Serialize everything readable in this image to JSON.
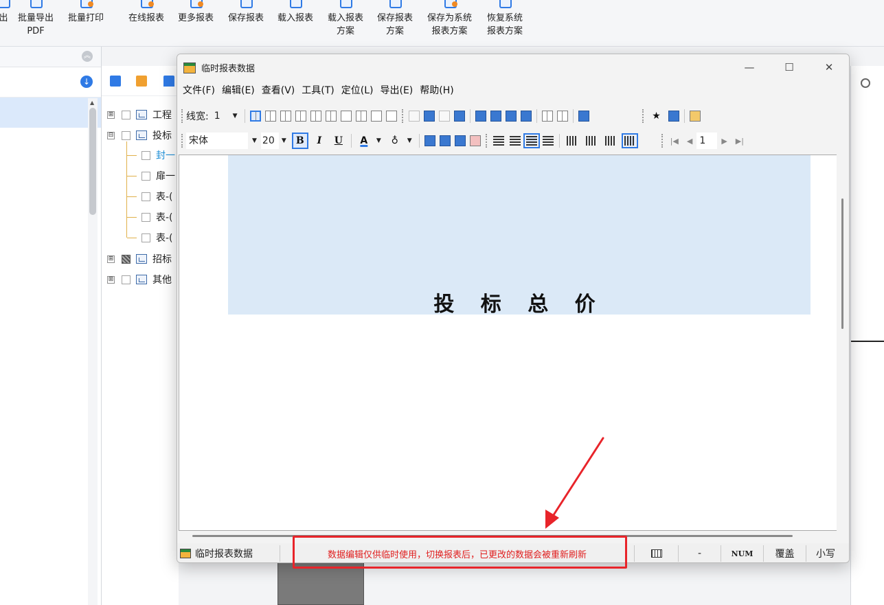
{
  "ribbon": {
    "buttons": [
      {
        "line1": "出",
        "line2": "",
        "icon": "export-icon"
      },
      {
        "line1": "批量导出",
        "line2": "PDF",
        "icon": "batch-export-pdf-icon"
      },
      {
        "line1": "批量打印",
        "line2": "",
        "icon": "batch-print-icon"
      },
      {
        "line1": "在线报表",
        "line2": "",
        "icon": "online-report-icon"
      },
      {
        "line1": "更多报表",
        "line2": "",
        "icon": "more-reports-icon"
      },
      {
        "line1": "保存报表",
        "line2": "",
        "icon": "save-report-icon"
      },
      {
        "line1": "载入报表",
        "line2": "",
        "icon": "load-report-icon"
      },
      {
        "line1": "载入报表",
        "line2": "方案",
        "icon": "load-report-scheme-icon"
      },
      {
        "line1": "保存报表",
        "line2": "方案",
        "icon": "save-report-scheme-icon"
      },
      {
        "line1": "保存为系统",
        "line2": "报表方案",
        "icon": "save-system-scheme-icon"
      },
      {
        "line1": "恢复系统",
        "line2": "报表方案",
        "icon": "restore-system-scheme-icon"
      }
    ]
  },
  "tree": {
    "roots": [
      {
        "expander": "⊞",
        "label": "工程"
      },
      {
        "expander": "⊟",
        "label": "投标"
      },
      {
        "expander": "⊞",
        "label": "招标"
      },
      {
        "expander": "⊞",
        "label": "其他"
      }
    ],
    "children": [
      "封一",
      "扉一",
      "表-(",
      "表-(",
      "表-("
    ]
  },
  "dialog": {
    "title": "临时报表数据",
    "controls": {
      "minimize": "—",
      "maximize": "☐",
      "close": "✕"
    },
    "menu": [
      "文件(F)",
      "编辑(E)",
      "查看(V)",
      "工具(T)",
      "定位(L)",
      "导出(E)",
      "帮助(H)"
    ],
    "toolbar1": {
      "line_width_label": "线宽:",
      "line_width_value": "1"
    },
    "toolbar2": {
      "font": "宋体",
      "size": "20",
      "bold": "B",
      "italic": "I",
      "underline": "U",
      "font_color": "A",
      "page": "1",
      "nav_first": "|◀",
      "nav_prev": "◀",
      "nav_next": "▶",
      "nav_last": "▶|"
    },
    "document": {
      "title": "投 标 总 价"
    },
    "status": {
      "name": "临时报表数据",
      "message": "数据编辑仅供临时使用，切换报表后，已更改的数据会被重新刷新",
      "dash": "-",
      "num": "NUM",
      "overwrite": "覆盖",
      "lowercase": "小写"
    }
  },
  "colors": {
    "accent": "#2f7ae5",
    "banner": "#dbe9f7",
    "annotation": "#e8242a",
    "status_message": "#e02020"
  }
}
